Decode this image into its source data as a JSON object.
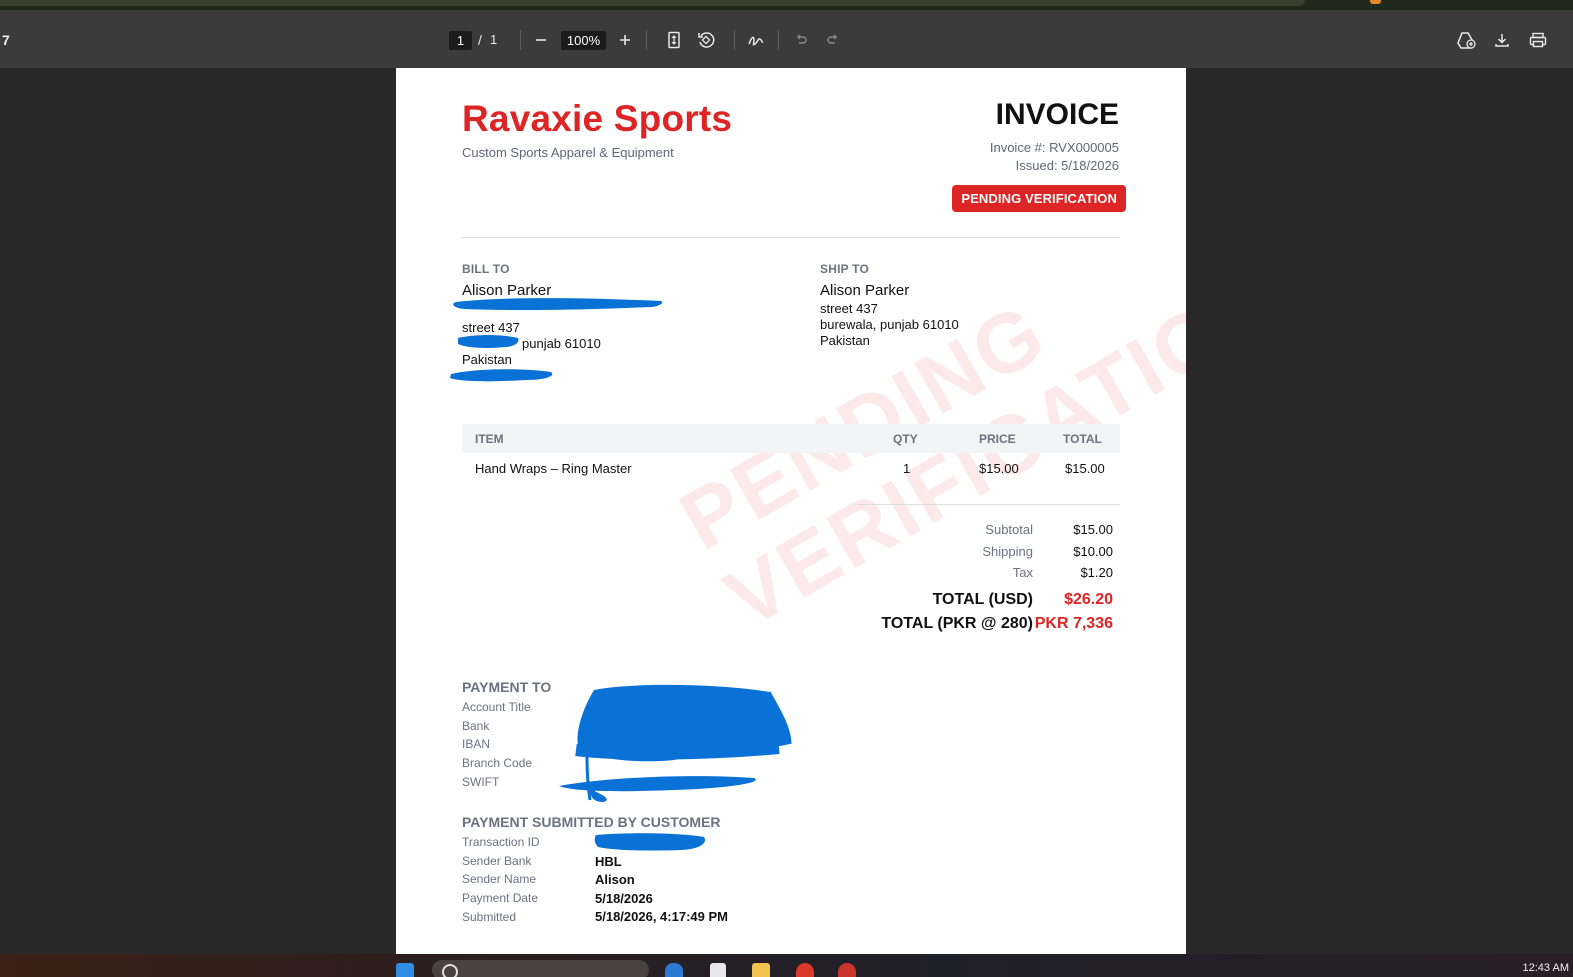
{
  "window": {
    "left_fragment": "7"
  },
  "toolbar": {
    "page_current": "1",
    "page_separator": "/",
    "page_total": "1",
    "zoom": "100%",
    "icons": [
      "zoom-out-icon",
      "zoom-in-icon",
      "fit-page-icon",
      "rotate-icon",
      "draw-icon",
      "undo-icon",
      "redo-icon",
      "add-to-drive-icon",
      "download-icon",
      "print-icon"
    ]
  },
  "invoice": {
    "brand": "Ravaxie Sports",
    "tagline": "Custom Sports Apparel & Equipment",
    "title": "INVOICE",
    "number": "Invoice #: RVX000005",
    "issued": "Issued: 5/18/2026",
    "status": "PENDING VERIFICATION",
    "watermark_line1": "PENDING",
    "watermark_line2": "VERIFICATION",
    "bill_to": {
      "label": "BILL TO",
      "name": "Alison Parker",
      "street": "street 437",
      "city_line": "punjab 61010",
      "country": "Pakistan"
    },
    "ship_to": {
      "label": "SHIP TO",
      "name": "Alison Parker",
      "street": "street 437",
      "city_line": "burewala, punjab 61010",
      "country": "Pakistan"
    },
    "table": {
      "headers": {
        "item": "ITEM",
        "qty": "QTY",
        "price": "PRICE",
        "total": "TOTAL"
      },
      "rows": [
        {
          "item": "Hand Wraps – Ring Master",
          "qty": "1",
          "price": "$15.00",
          "total": "$15.00"
        }
      ]
    },
    "totals": {
      "subtotal_label": "Subtotal",
      "subtotal": "$15.00",
      "shipping_label": "Shipping",
      "shipping": "$10.00",
      "tax_label": "Tax",
      "tax": "$1.20",
      "usd_label": "TOTAL (USD)",
      "usd": "$26.20",
      "pkr_label": "TOTAL (PKR @ 280)",
      "pkr": "PKR 7,336"
    },
    "payment_to": {
      "heading": "PAYMENT TO",
      "fields": [
        "Account Title",
        "Bank",
        "IBAN",
        "Branch Code",
        "SWIFT"
      ]
    },
    "payment_submitted": {
      "heading": "PAYMENT SUBMITTED BY CUSTOMER",
      "rows": [
        {
          "key": "Transaction ID",
          "value": ""
        },
        {
          "key": "Sender Bank",
          "value": "HBL"
        },
        {
          "key": "Sender Name",
          "value": "Alison"
        },
        {
          "key": "Payment Date",
          "value": "5/18/2026"
        },
        {
          "key": "Submitted",
          "value": "5/18/2026, 4:17:49 PM"
        }
      ]
    }
  },
  "colors": {
    "brand_red": "#dd2525",
    "redaction_blue": "#0a72d6",
    "toolbar_bg": "#3b3b3b"
  },
  "taskbar": {
    "clock": "12:43 AM"
  }
}
